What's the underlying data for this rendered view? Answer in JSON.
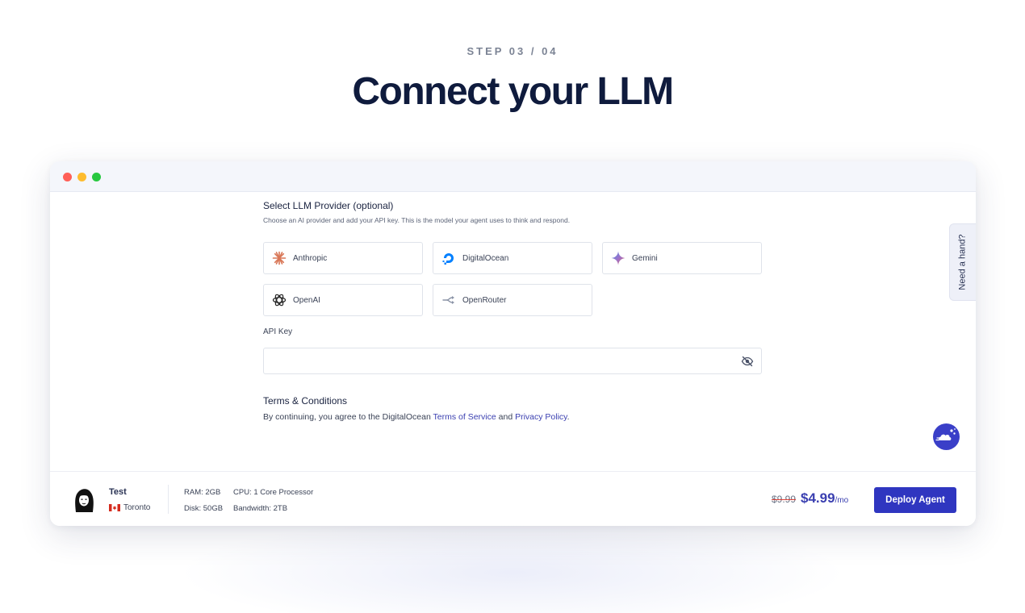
{
  "header": {
    "step": "STEP 03 / 04",
    "title": "Connect your LLM"
  },
  "provider_section": {
    "title": "Select LLM Provider (optional)",
    "subtitle": "Choose an AI provider and add your API key. This is the model your agent uses to think and respond.",
    "providers": [
      {
        "label": "Anthropic",
        "icon": "anthropic-icon"
      },
      {
        "label": "DigitalOcean",
        "icon": "digitalocean-icon"
      },
      {
        "label": "Gemini",
        "icon": "gemini-icon"
      },
      {
        "label": "OpenAI",
        "icon": "openai-icon"
      },
      {
        "label": "OpenRouter",
        "icon": "openrouter-icon"
      }
    ]
  },
  "api_key": {
    "label": "API Key",
    "value": "",
    "placeholder": ""
  },
  "terms": {
    "title": "Terms & Conditions",
    "prefix": "By continuing, you agree to the DigitalOcean ",
    "tos_link": "Terms of Service",
    "and": " and ",
    "privacy_link": "Privacy Policy",
    "suffix": "."
  },
  "help_tab": {
    "label": "Need a hand?"
  },
  "footer": {
    "agent_name": "Test",
    "location": "Toronto",
    "ram": "RAM: 2GB",
    "disk": "Disk: 50GB",
    "cpu": "CPU: 1 Core Processor",
    "bandwidth": "Bandwidth: 2TB",
    "old_price": "$9.99",
    "new_price": "$4.99",
    "per": "/mo",
    "deploy_label": "Deploy Agent"
  },
  "colors": {
    "accent": "#2f36c0",
    "title": "#0f1b3d",
    "anthropic": "#d97757",
    "digitalocean": "#0080ff"
  }
}
